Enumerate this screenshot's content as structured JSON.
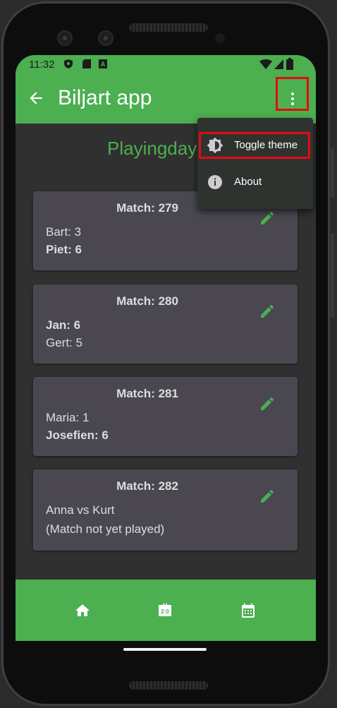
{
  "status_bar": {
    "time": "11:32"
  },
  "app_bar": {
    "title": "Biljart app"
  },
  "content": {
    "playingday_label": "Playingday:",
    "matches": [
      {
        "title": "Match: 279",
        "line1": "Bart: 3",
        "line2": "Piet: 6",
        "line1_bold": false,
        "line2_bold": true
      },
      {
        "title": "Match: 280",
        "line1": "Jan: 6",
        "line2": "Gert: 5",
        "line1_bold": true,
        "line2_bold": false
      },
      {
        "title": "Match: 281",
        "line1": "Maria: 1",
        "line2": "Josefien: 6",
        "line1_bold": false,
        "line2_bold": true
      },
      {
        "title": "Match: 282",
        "line1": "Anna vs Kurt",
        "line2": "(Match not yet played)",
        "line1_bold": false,
        "line2_bold": false
      }
    ]
  },
  "overflow_menu": {
    "items": [
      {
        "label": "Toggle theme",
        "icon": "brightness-icon"
      },
      {
        "label": "About",
        "icon": "info-icon"
      }
    ]
  },
  "bottom_nav": {
    "items": [
      {
        "icon": "home-icon"
      },
      {
        "icon": "scoreboard-icon"
      },
      {
        "icon": "calendar-icon"
      }
    ]
  },
  "colors": {
    "accent": "#4caf50",
    "card": "#4a4750",
    "background": "#303030",
    "highlight": "#e50914"
  }
}
